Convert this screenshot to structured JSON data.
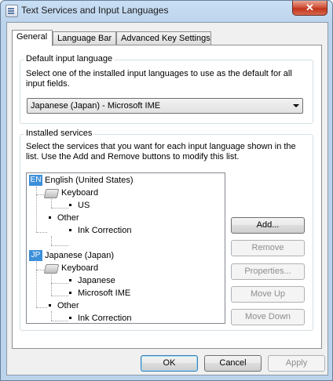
{
  "window": {
    "title": "Text Services and Input Languages",
    "close_glyph": "✕"
  },
  "tabs": [
    {
      "label": "General"
    },
    {
      "label": "Language Bar"
    },
    {
      "label": "Advanced Key Settings"
    }
  ],
  "default_input": {
    "label": "Default input language",
    "description": "Select one of the installed input languages to use as the default for all input fields.",
    "selected": "Japanese (Japan) - Microsoft IME"
  },
  "installed": {
    "label": "Installed services",
    "description": "Select the services that you want for each input language shown in the list. Use the Add and Remove buttons to modify this list.",
    "tree": {
      "english": {
        "badge": "EN",
        "label": "English (United States)",
        "keyboard": "Keyboard",
        "keyboard_item": "US",
        "other": "Other",
        "other_item": "Ink Correction"
      },
      "japanese": {
        "badge": "JP",
        "label": "Japanese (Japan)",
        "keyboard": "Keyboard",
        "keyboard_item_1": "Japanese",
        "keyboard_item_2": "Microsoft IME",
        "other": "Other",
        "other_item": "Ink Correction"
      }
    },
    "buttons": {
      "add": "Add...",
      "remove": "Remove",
      "properties": "Properties...",
      "move_up": "Move Up",
      "move_down": "Move Down"
    }
  },
  "footer": {
    "ok": "OK",
    "cancel": "Cancel",
    "apply": "Apply"
  },
  "colors": {
    "badge": "#3c8fd9",
    "close": "#c2331b",
    "titlebar": "#bcd3ec"
  }
}
